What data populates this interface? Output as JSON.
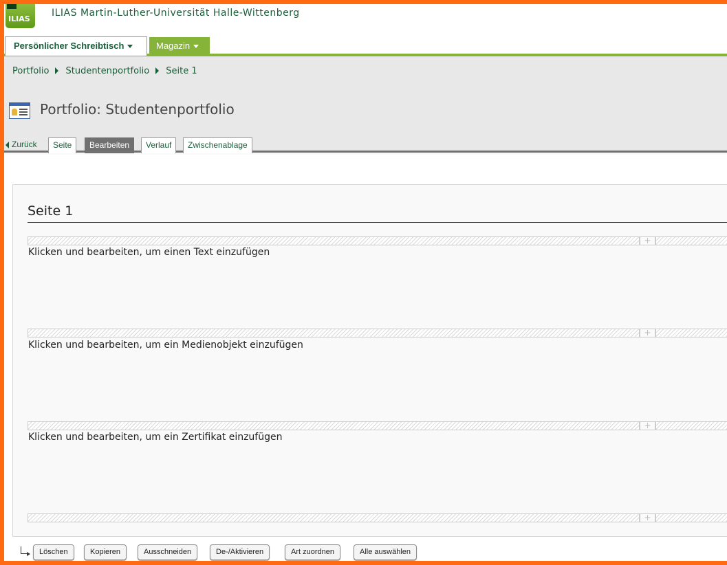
{
  "header": {
    "logo_text": "ILIAS",
    "installation_title": "ILIAS Martin-Luther-Universität Halle-Wittenberg"
  },
  "main_menu": [
    {
      "label": "Persönlicher Schreibtisch"
    },
    {
      "label": "Magazin"
    }
  ],
  "breadcrumb": [
    "Portfolio",
    "Studentenportfolio",
    "Seite 1"
  ],
  "page_title": "Portfolio: Studentenportfolio",
  "sub_tabs": {
    "back": "Zurück",
    "items": [
      "Seite",
      "Bearbeiten",
      "Verlauf",
      "Zwischenablage"
    ],
    "active": "Bearbeiten"
  },
  "editor": {
    "page_heading": "Seite 1",
    "placeholders": [
      "Klicken und bearbeiten, um einen Text einzufügen",
      "Klicken und bearbeiten, um ein Medienobjekt einzufügen",
      "Klicken und bearbeiten, um ein Zertifikat einzufügen"
    ],
    "add_symbol": "+"
  },
  "actions": [
    "Löschen",
    "Kopieren",
    "Ausschneiden",
    "De-/Aktivieren",
    "Art zuordnen",
    "Alle auswählen"
  ],
  "colors": {
    "frame": "#ff6a13",
    "accent_green": "#86b439",
    "link_green": "#1b5e3a",
    "active_tab": "#707070"
  }
}
